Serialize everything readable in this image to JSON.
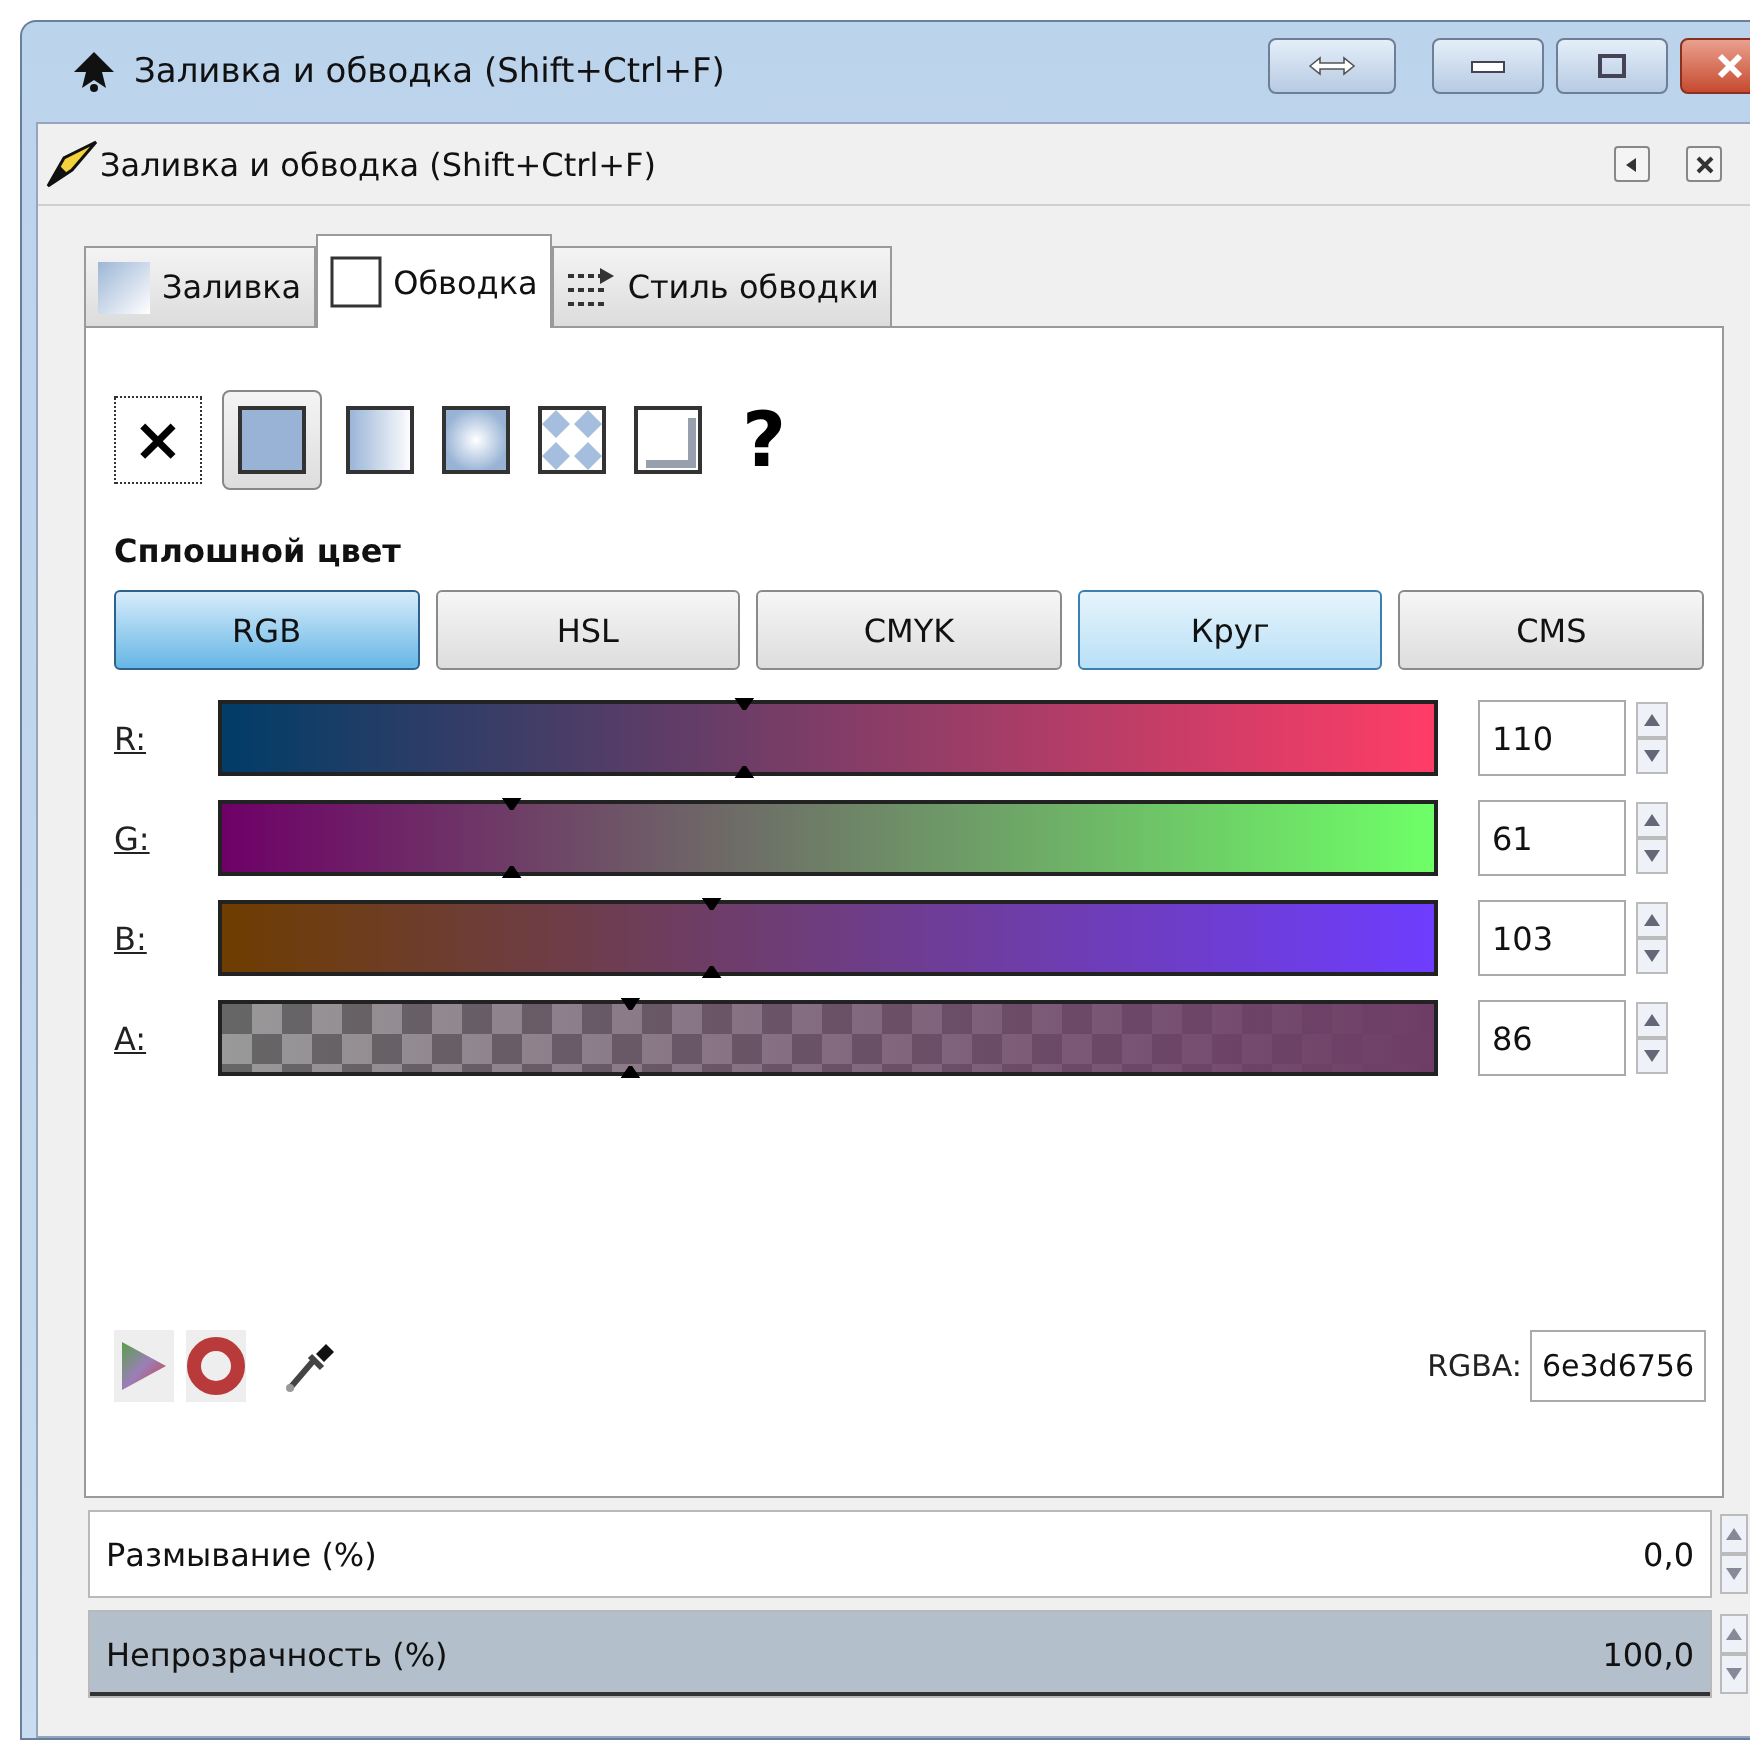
{
  "window": {
    "title": "Заливка и обводка (Shift+Ctrl+F)"
  },
  "dock": {
    "title": "Заливка и обводка (Shift+Ctrl+F)"
  },
  "tabs": [
    {
      "label": "Заливка",
      "kind": "fill",
      "selected": false
    },
    {
      "label": "Обводка",
      "kind": "stroke",
      "selected": true
    },
    {
      "label": "Стиль обводки",
      "kind": "style",
      "selected": false
    }
  ],
  "paint_types": [
    {
      "kind": "none",
      "label": "×",
      "selected": false
    },
    {
      "kind": "flat",
      "selected": true
    },
    {
      "kind": "linear",
      "selected": false
    },
    {
      "kind": "radial",
      "selected": false
    },
    {
      "kind": "pattern",
      "selected": false
    },
    {
      "kind": "swatch",
      "selected": false
    },
    {
      "kind": "unset",
      "label": "?",
      "selected": false
    }
  ],
  "section_title": "Сплошной цвет",
  "modes": [
    {
      "label": "RGB",
      "selected": true,
      "hovered": false
    },
    {
      "label": "HSL",
      "selected": false,
      "hovered": false
    },
    {
      "label": "CMYK",
      "selected": false,
      "hovered": false
    },
    {
      "label": "Круг",
      "selected": false,
      "hovered": true
    },
    {
      "label": "CMS",
      "selected": false,
      "hovered": false
    }
  ],
  "channels": [
    {
      "name": "R:",
      "kind": "red",
      "level": 0.431,
      "value": "110"
    },
    {
      "name": "G:",
      "kind": "green",
      "level": 0.239,
      "value": "61"
    },
    {
      "name": "B:",
      "kind": "blue",
      "level": 0.404,
      "value": "103"
    },
    {
      "name": "A:",
      "kind": "alpha",
      "level": 0.337,
      "value": "86"
    }
  ],
  "rgba": {
    "label": "RGBA:",
    "value": "6e3d6756"
  },
  "blur": {
    "label": "Размывание (%)",
    "value": "0,0"
  },
  "opacity": {
    "label": "Непрозрачность (%)",
    "value": "100,0",
    "level": 1
  }
}
